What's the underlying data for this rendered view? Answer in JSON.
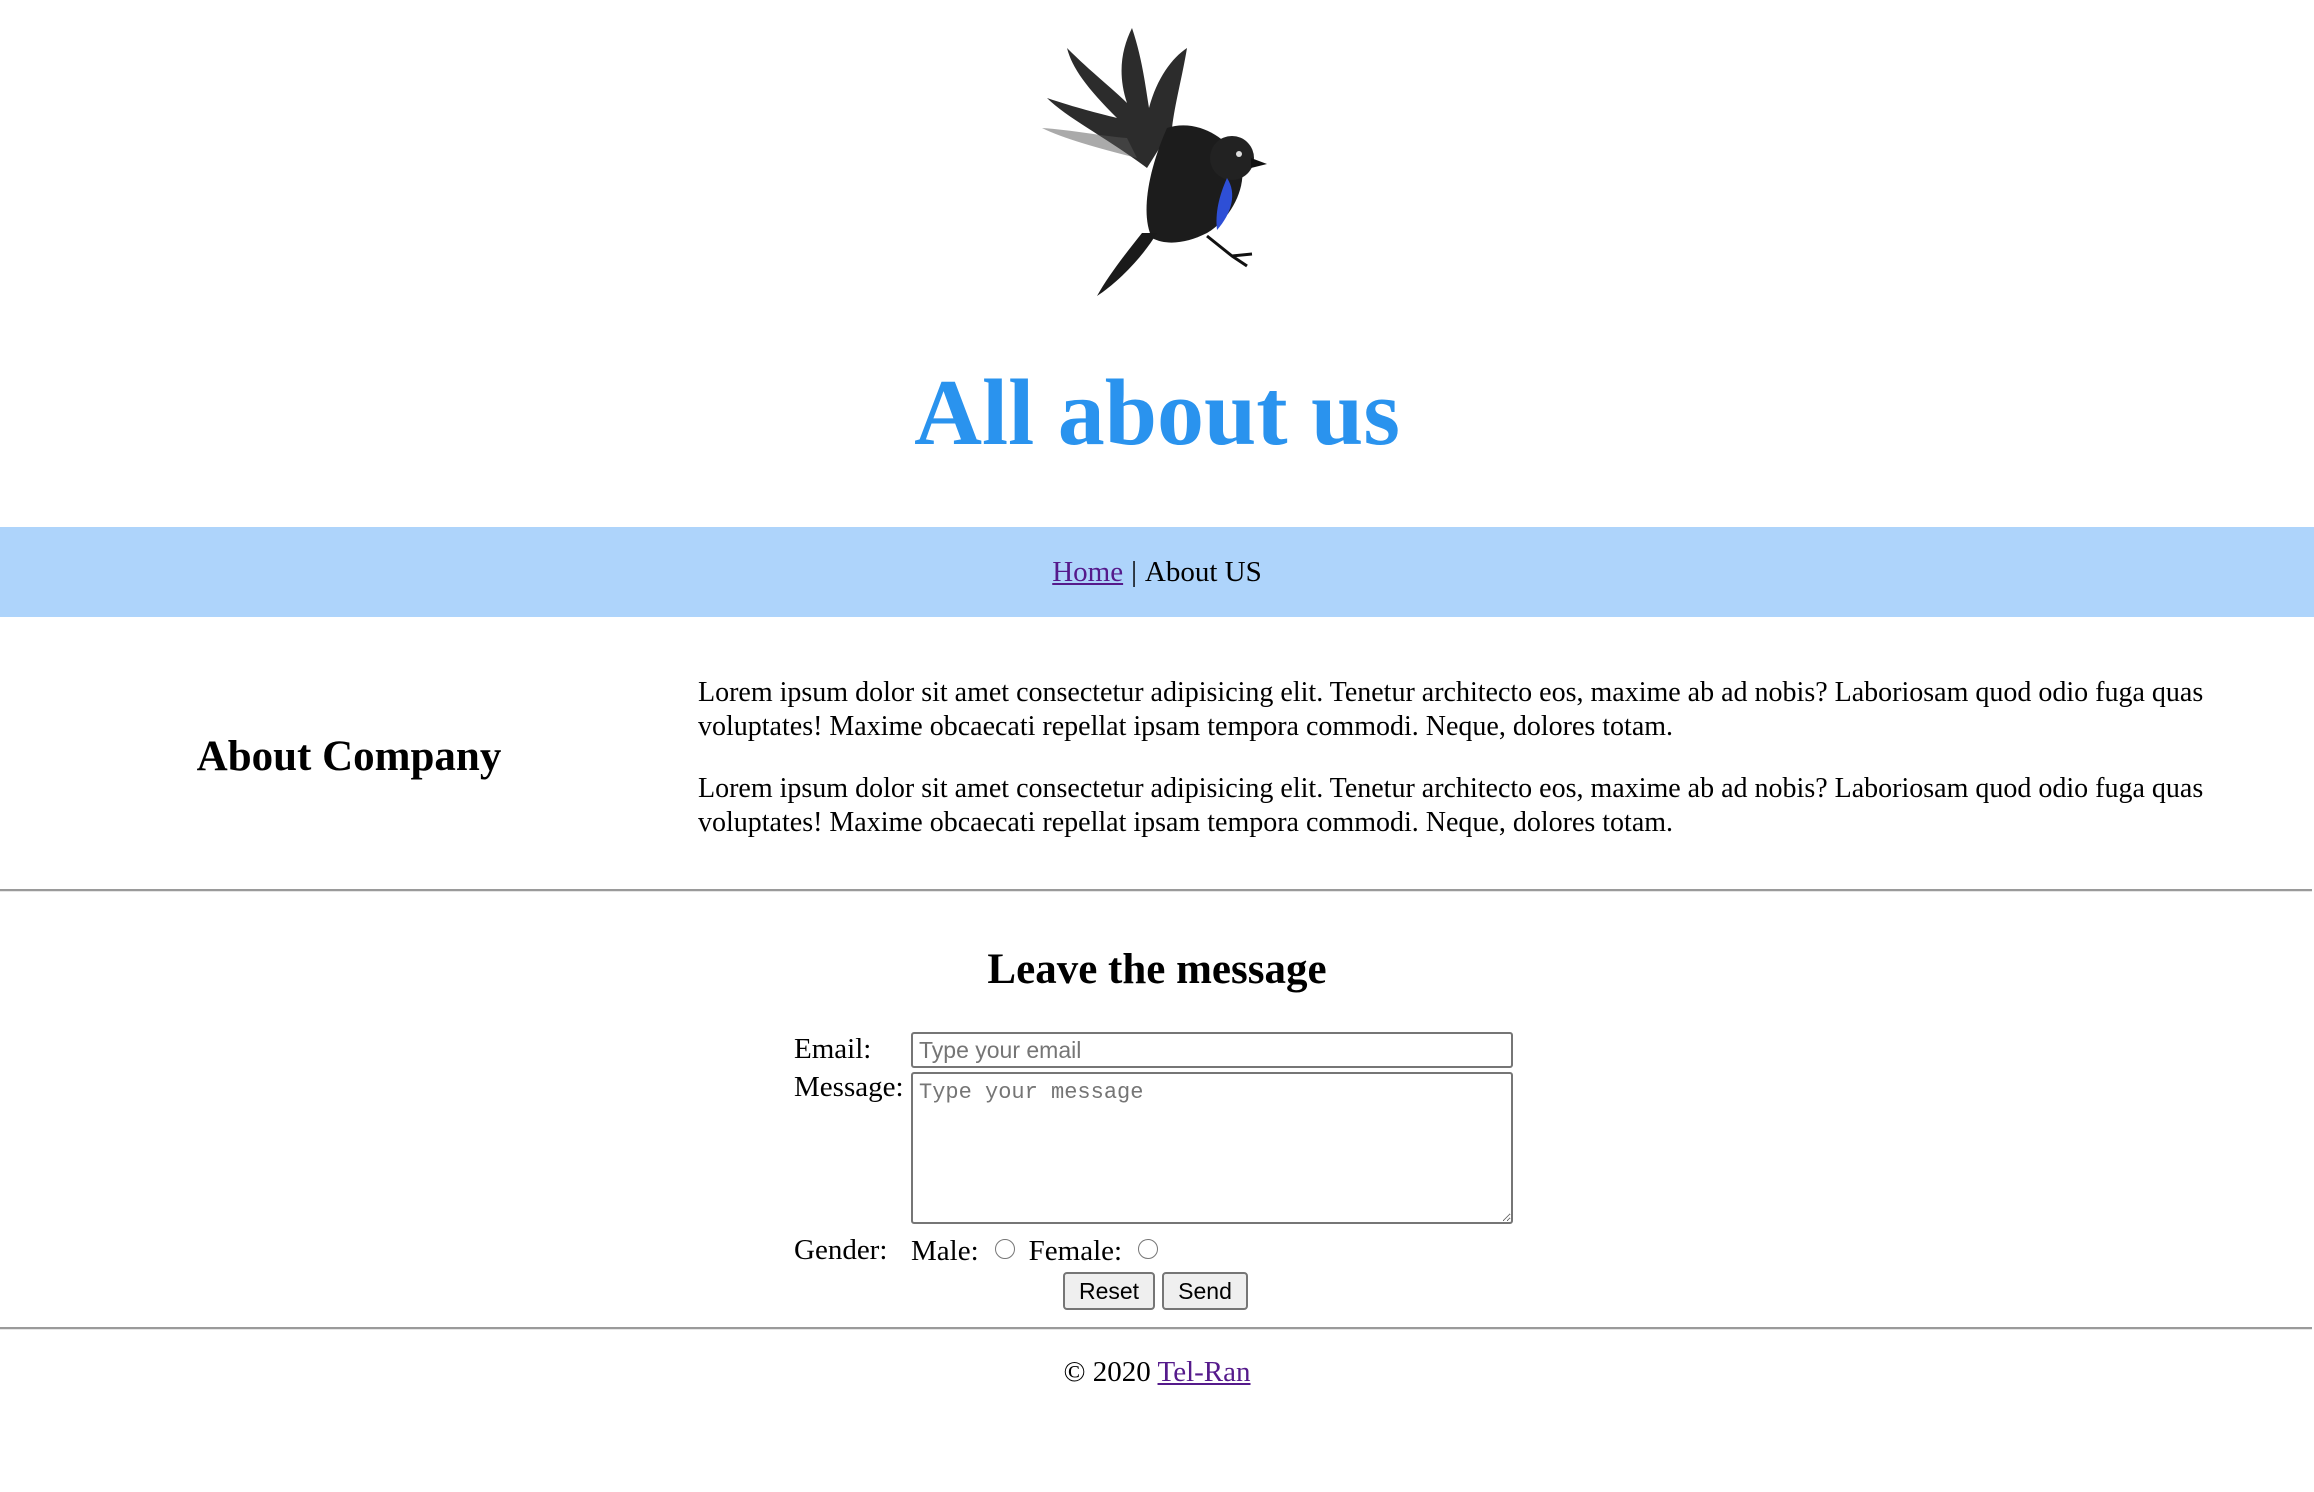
{
  "header": {
    "logo_icon": "flying-bird-icon",
    "title": "All about us",
    "title_color": "#2a93ee"
  },
  "nav": {
    "home_label": "Home",
    "separator": "|",
    "current_label": "About US",
    "bg_color": "#aed4fb"
  },
  "about": {
    "heading": "About Company",
    "paragraphs": [
      "Lorem ipsum dolor sit amet consectetur adipisicing elit. Tenetur architecto eos, maxime ab ad nobis? Laboriosam quod odio fuga quas voluptates! Maxime obcaecati repellat ipsam tempora commodi. Neque, dolores totam.",
      "Lorem ipsum dolor sit amet consectetur adipisicing elit. Tenetur architecto eos, maxime ab ad nobis? Laboriosam quod odio fuga quas voluptates! Maxime obcaecati repellat ipsam tempora commodi. Neque, dolores totam."
    ]
  },
  "form": {
    "heading": "Leave the message",
    "email_label": "Email:",
    "email_placeholder": "Type your email",
    "message_label": "Message:",
    "message_placeholder": "Type your message",
    "gender_label": "Gender:",
    "male_label": "Male:",
    "female_label": "Female:",
    "reset_label": "Reset",
    "send_label": "Send"
  },
  "footer": {
    "copyright": "© 2020",
    "link_label": "Tel-Ran"
  }
}
